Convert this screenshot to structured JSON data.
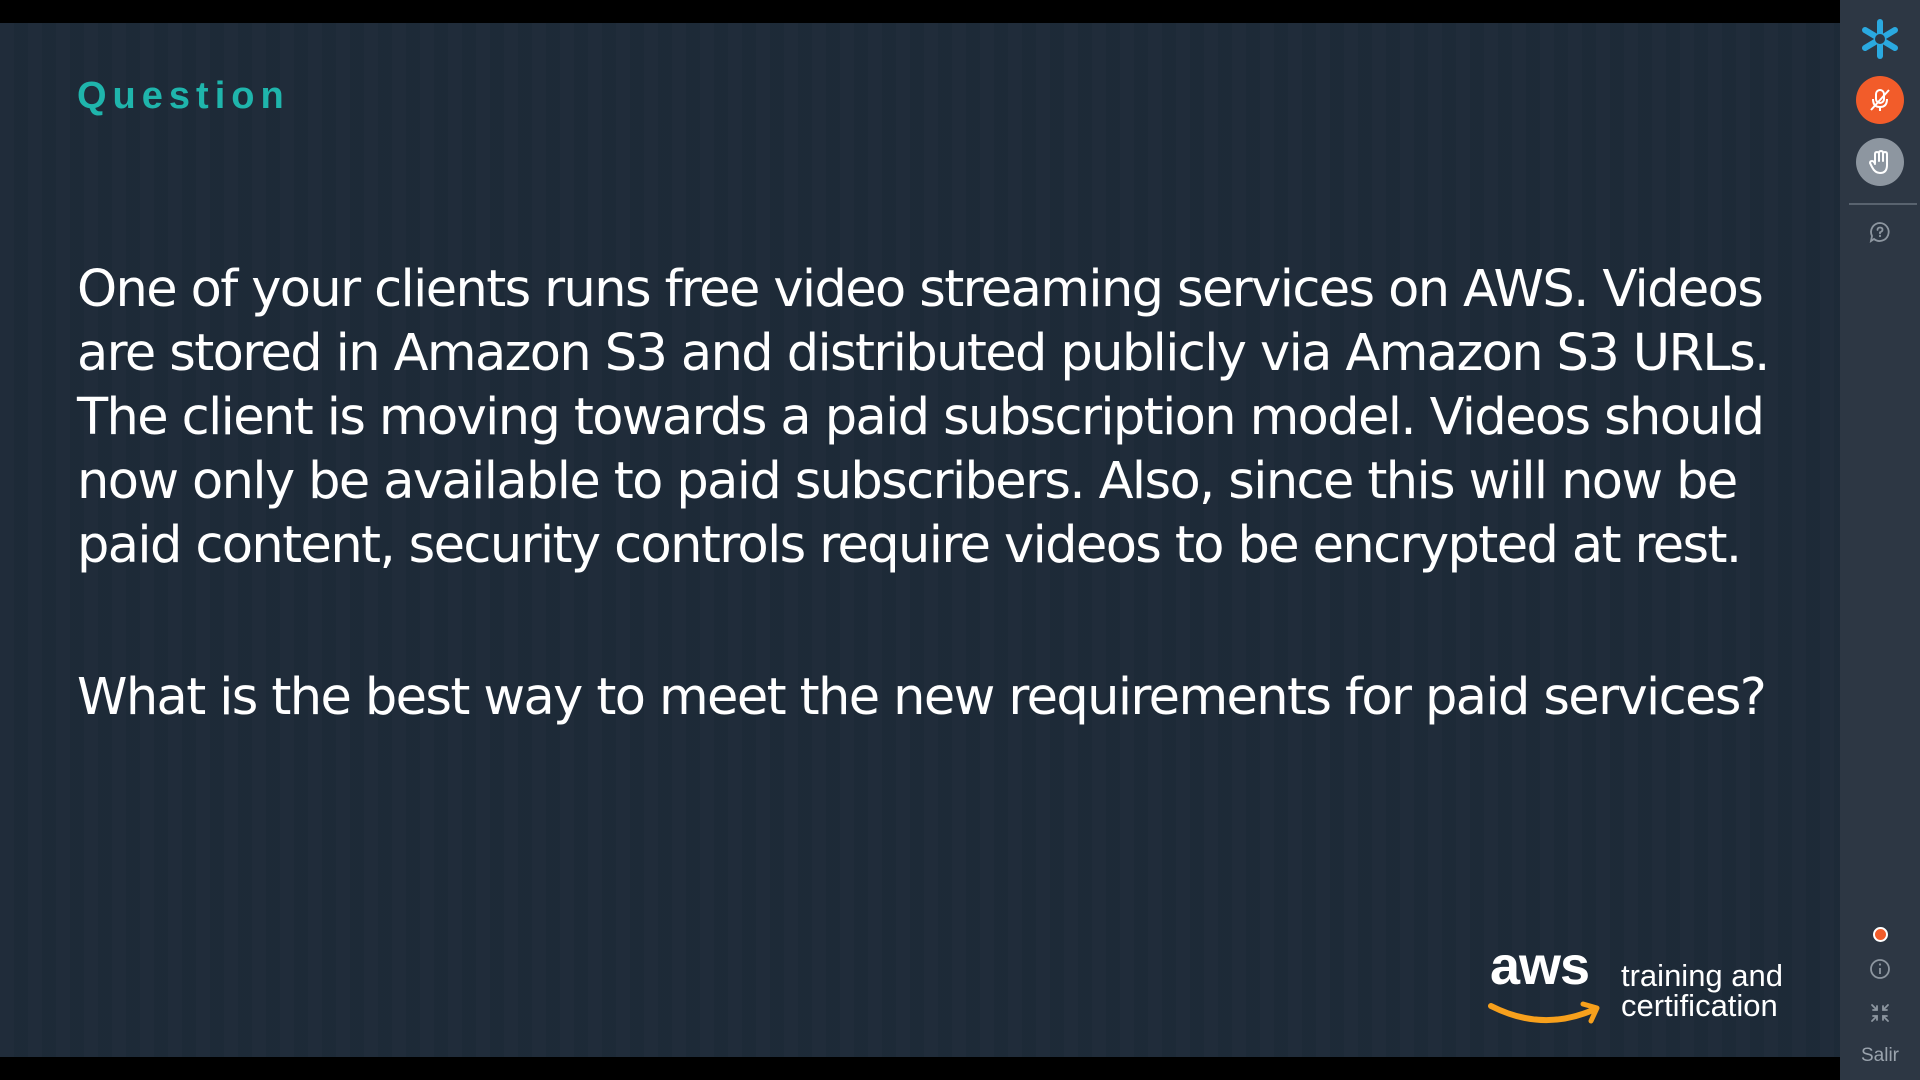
{
  "slide": {
    "heading": "Question",
    "paragraph_lines": [
      "One of your clients runs free video streaming services on AWS. Videos",
      "are stored in Amazon S3 and distributed publicly via Amazon S3 URLs.",
      "The client is moving towards a paid subscription model. Videos should",
      "now only be available to paid subscribers. Also, since this will now be",
      "paid content, security controls require videos to be encrypted at rest."
    ],
    "question": "What is the best way to meet the new requirements for paid services?",
    "brand": {
      "logo_text": "aws",
      "tagline_line1": "training and",
      "tagline_line2": "certification"
    }
  },
  "side_rail": {
    "items": [
      {
        "icon": "app-logo-icon"
      },
      {
        "icon": "microphone-muted-icon",
        "color": "#f25c2a"
      },
      {
        "icon": "raise-hand-icon"
      },
      {
        "icon": "help-chat-icon"
      },
      {
        "icon": "status-dot",
        "color": "#f25c2a"
      },
      {
        "icon": "info-icon"
      },
      {
        "icon": "collapse-icon"
      }
    ],
    "exit_label": "Salir"
  },
  "colors": {
    "slide_background": "#1d2a38",
    "heading": "#1fb5ac",
    "aws_orange": "#f7a01c",
    "rail_background": "#2d3744",
    "mic_button": "#f25c2a"
  }
}
